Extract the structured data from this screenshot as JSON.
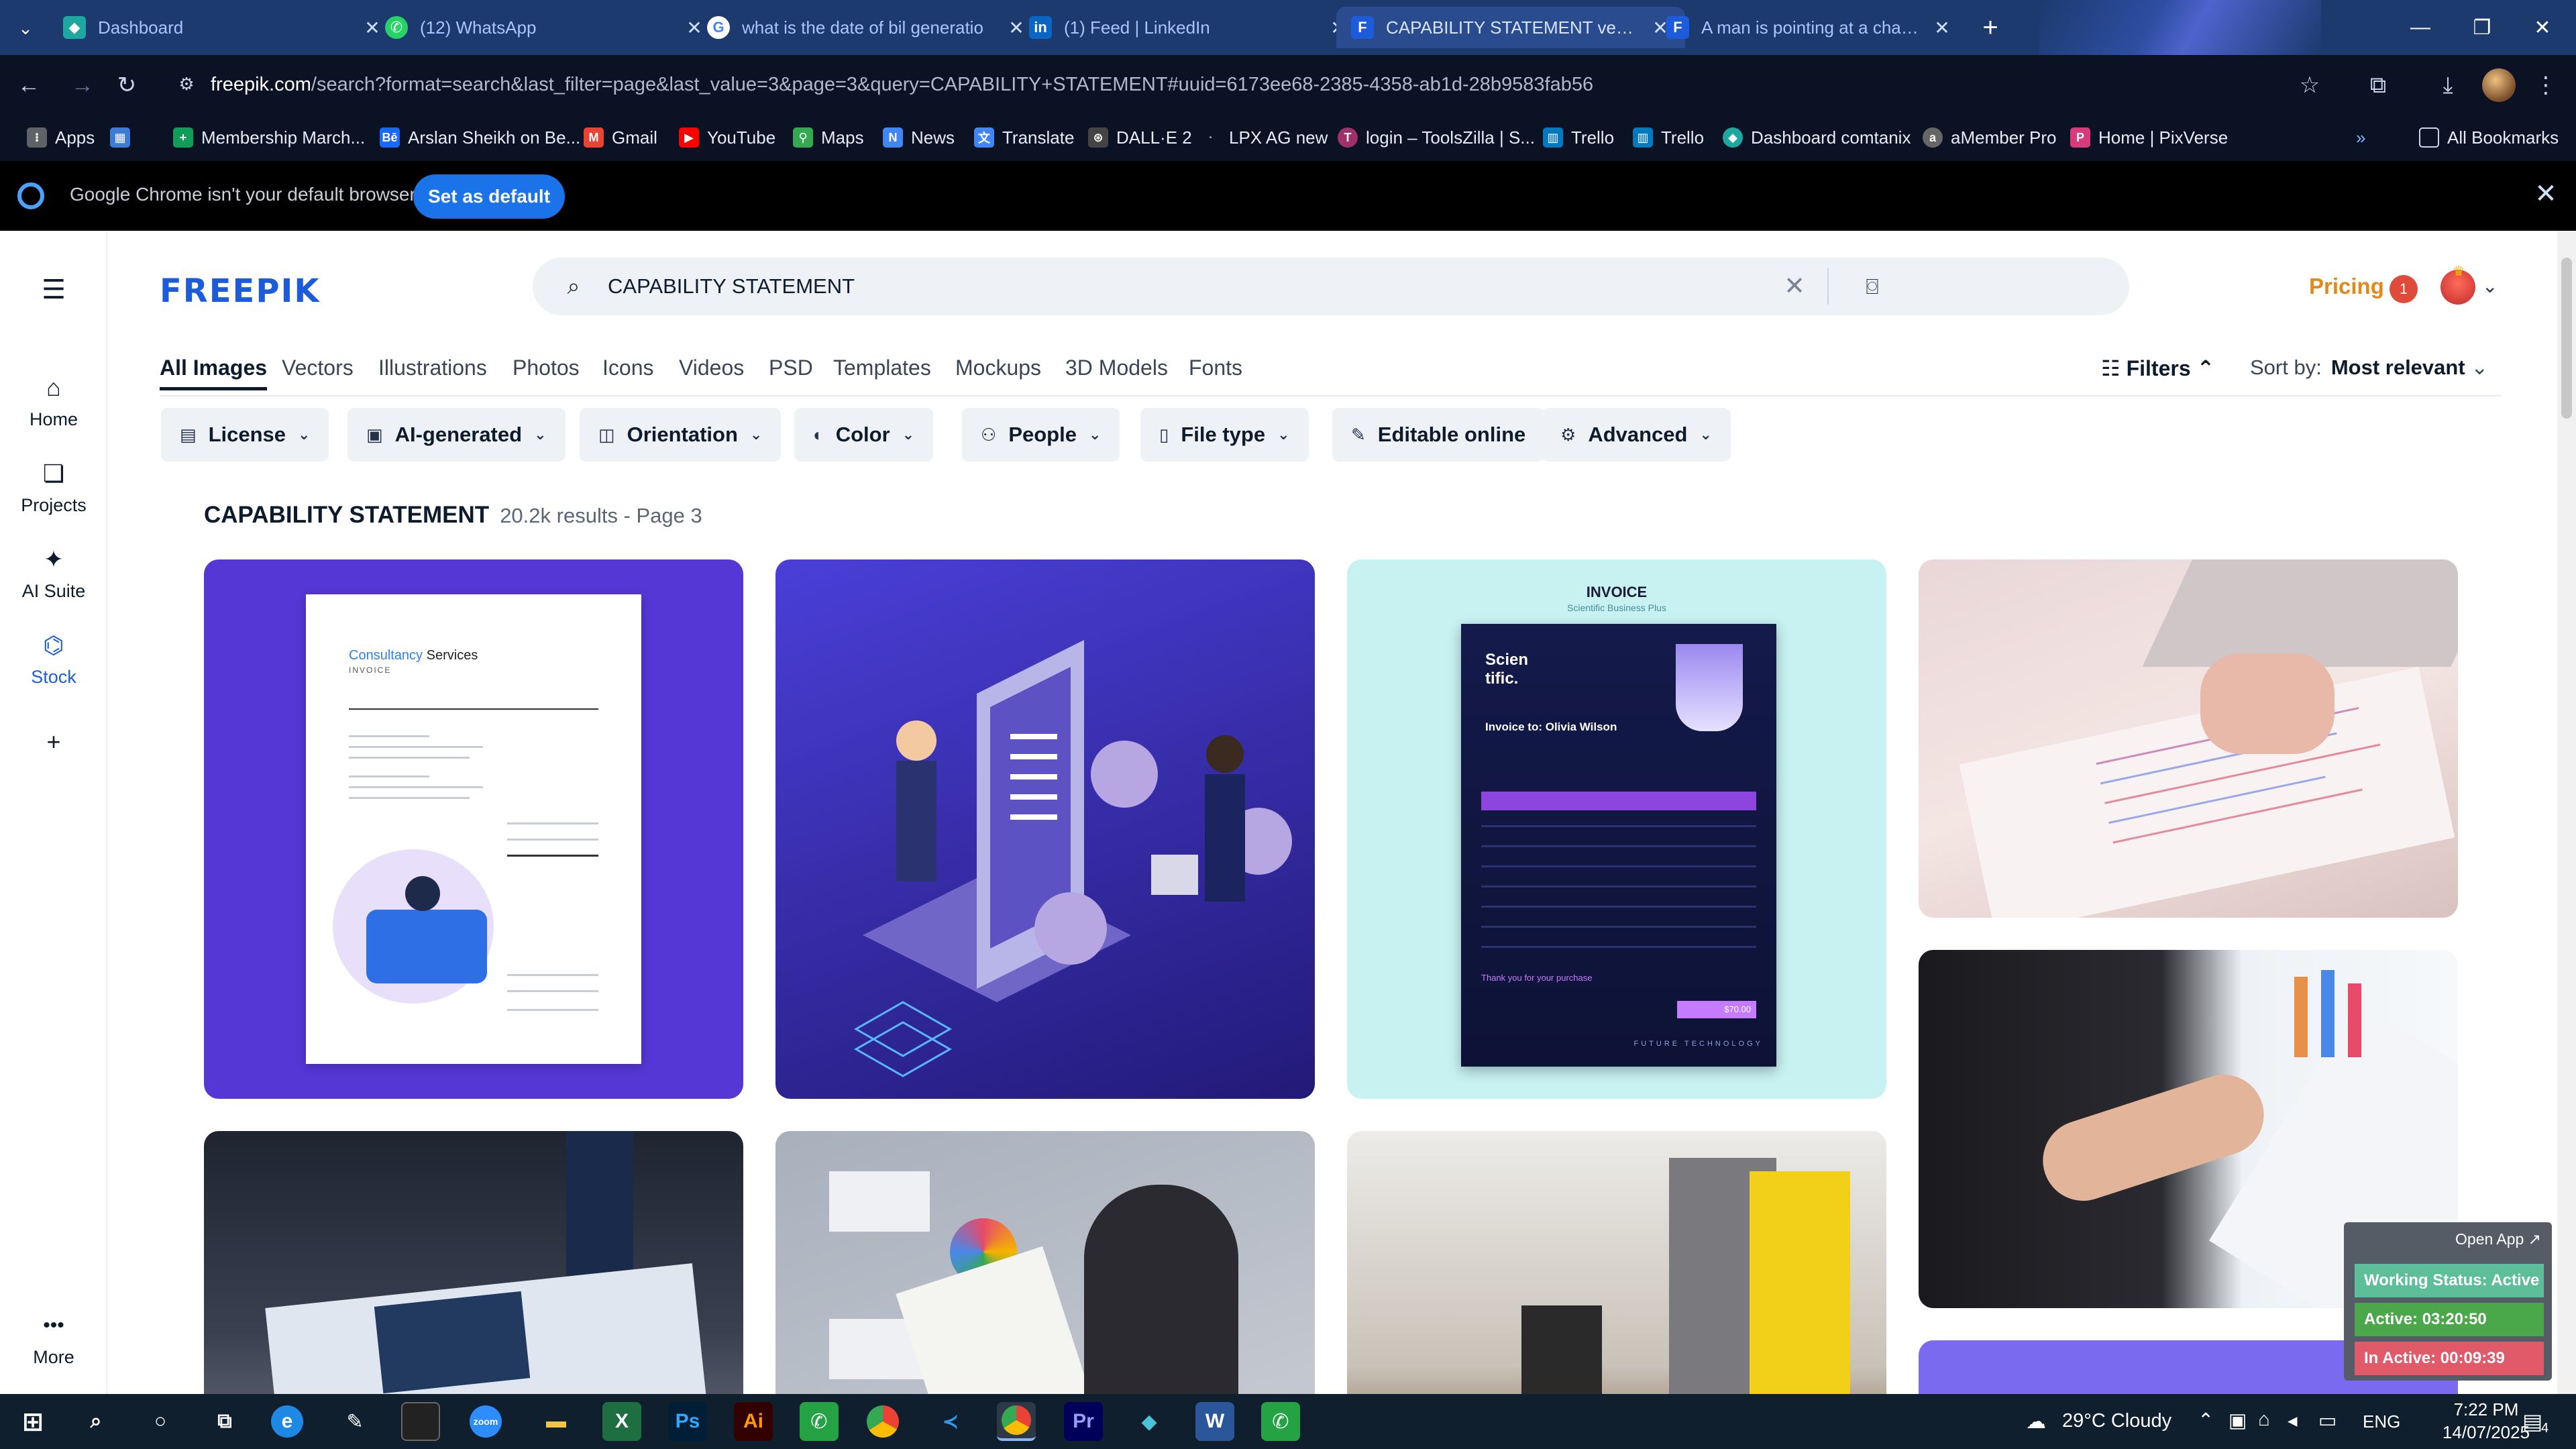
{
  "browser": {
    "tabs": [
      {
        "title": "Dashboard",
        "icon": "dashboard-icon",
        "color": "#1ea7a0"
      },
      {
        "title": "(12) WhatsApp",
        "icon": "whatsapp-icon",
        "color": "#25d366"
      },
      {
        "title": "what is the date of bil generatio",
        "icon": "google-icon",
        "color": "#4285f4"
      },
      {
        "title": "(1) Feed | LinkedIn",
        "icon": "linkedin-icon",
        "color": "#0a66c2"
      },
      {
        "title": "CAPABILITY STATEMENT vector",
        "icon": "freepik-icon",
        "color": "#1c5bd9"
      },
      {
        "title": "A man is pointing at a chart tha",
        "icon": "freepik-icon",
        "color": "#1c5bd9"
      }
    ],
    "url_host": "freepik.com",
    "url_rest": "/search?format=search&last_filter=page&last_value=3&page=3&query=CAPABILITY+STATEMENT#uuid=6173ee68-2385-4358-ab1d-28b9583fab56",
    "bookmarks": [
      {
        "label": "Apps",
        "color": "#5f6368"
      },
      {
        "label": "",
        "color": "#3c7bd6"
      },
      {
        "label": "Membership March...",
        "color": "#0f9d58"
      },
      {
        "label": "Arslan Sheikh on Be...",
        "color": "#1769ff"
      },
      {
        "label": "Gmail",
        "color": "#ea4335"
      },
      {
        "label": "YouTube",
        "color": "#ff0000"
      },
      {
        "label": "Maps",
        "color": "#34a853"
      },
      {
        "label": "News",
        "color": "#4285f4"
      },
      {
        "label": "Translate",
        "color": "#4285f4"
      },
      {
        "label": "DALL·E 2",
        "color": "#444444"
      },
      {
        "label": "LPX AG new",
        "color": "#555555"
      },
      {
        "label": "login – ToolsZilla | S...",
        "color": "#a0306a"
      },
      {
        "label": "Trello",
        "color": "#0079bf"
      },
      {
        "label": "Trello",
        "color": "#0079bf"
      },
      {
        "label": "Dashboard comtanix",
        "color": "#1ea7a0"
      },
      {
        "label": "aMember Pro",
        "color": "#666666"
      },
      {
        "label": "Home | PixVerse",
        "color": "#d93a7a"
      }
    ],
    "all_bookmarks": "All Bookmarks",
    "infobar_msg": "Google Chrome isn't your default browser",
    "infobar_btn": "Set as default"
  },
  "rail": {
    "items": [
      {
        "label": "Home",
        "icon": "home-icon"
      },
      {
        "label": "Projects",
        "icon": "projects-icon"
      },
      {
        "label": "AI Suite",
        "icon": "ai-suite-icon"
      },
      {
        "label": "Stock",
        "icon": "stock-icon"
      }
    ],
    "more": "More"
  },
  "header": {
    "logo": "FREEPIK",
    "search_value": "CAPABILITY STATEMENT",
    "pricing": "Pricing",
    "notif_count": "1"
  },
  "categories": [
    "All Images",
    "Vectors",
    "Illustrations",
    "Photos",
    "Icons",
    "Videos",
    "PSD",
    "Templates",
    "Mockups",
    "3D Models",
    "Fonts"
  ],
  "filters_label": "Filters",
  "sort": {
    "label": "Sort by:",
    "value": "Most relevant"
  },
  "chips": [
    "License",
    "AI-generated",
    "Orientation",
    "Color",
    "People",
    "File type",
    "Editable online",
    "Advanced"
  ],
  "results": {
    "query": "CAPABILITY STATEMENT",
    "summary": "20.2k results - Page 3"
  },
  "tile_text": {
    "invoice_title": "INVOICE",
    "invoice_sub": "Scientific Business Plus",
    "consult_a": "Consultancy",
    "consult_b": "Services",
    "consult_inv": "INVOICE",
    "scientific": "Scien tific.",
    "invoice_to": "Invoice to: Olivia Wilson",
    "thanks": "Thank you for your purchase",
    "future": "FUTURE TECHNOLOGY",
    "total": "$70.00"
  },
  "timer": {
    "open_app": "Open App ↗",
    "working": "Working Status: Active",
    "active": "Active: 03:20:50",
    "inactive": "In Active: 00:09:39"
  },
  "taskbar": {
    "weather": "29°C  Cloudy",
    "lang": "ENG",
    "time": "7:22 PM",
    "date": "14/07/2025",
    "notif": "4"
  }
}
